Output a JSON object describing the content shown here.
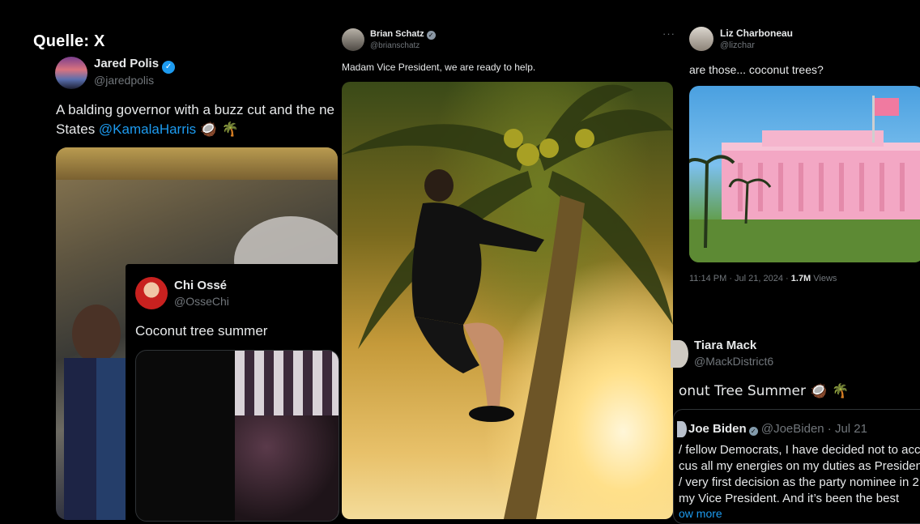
{
  "source_label": "Quelle: X",
  "polis": {
    "name": "Jared Polis",
    "handle": "@jaredpolis",
    "text_line1": "A balding governor with a buzz cut and the ne",
    "text_line2_prefix": "States ",
    "mention": "@KamalaHarris",
    "emojis": "🥥 🌴"
  },
  "osse": {
    "name": "Chi Ossé",
    "handle": "@OsseChi",
    "text": "Coconut tree summer"
  },
  "schatz": {
    "name": "Brian Schatz",
    "handle": "@brianschatz",
    "more": "···",
    "text": "Madam Vice President, we are ready to help."
  },
  "liz": {
    "name": "Liz Charboneau",
    "handle": "@lizchar",
    "text": "are those... coconut trees?",
    "timestamp": "11:14 PM · Jul 21, 2024 · ",
    "views_count": "1.7M",
    "views_label": " Views"
  },
  "tiara": {
    "name": "Tiara Mack",
    "handle": "@MackDistrict6",
    "text": "onut Tree Summer 🥥 🌴"
  },
  "biden": {
    "name": "Joe Biden",
    "meta": " @JoeBiden · Jul 21",
    "lines": [
      "/ fellow Democrats, I have decided not to acc",
      "cus all my energies on my duties as Presiden",
      "/ very first decision as the party nominee in 2",
      " my Vice President. And it’s been the best"
    ],
    "show_more": "ow more"
  }
}
